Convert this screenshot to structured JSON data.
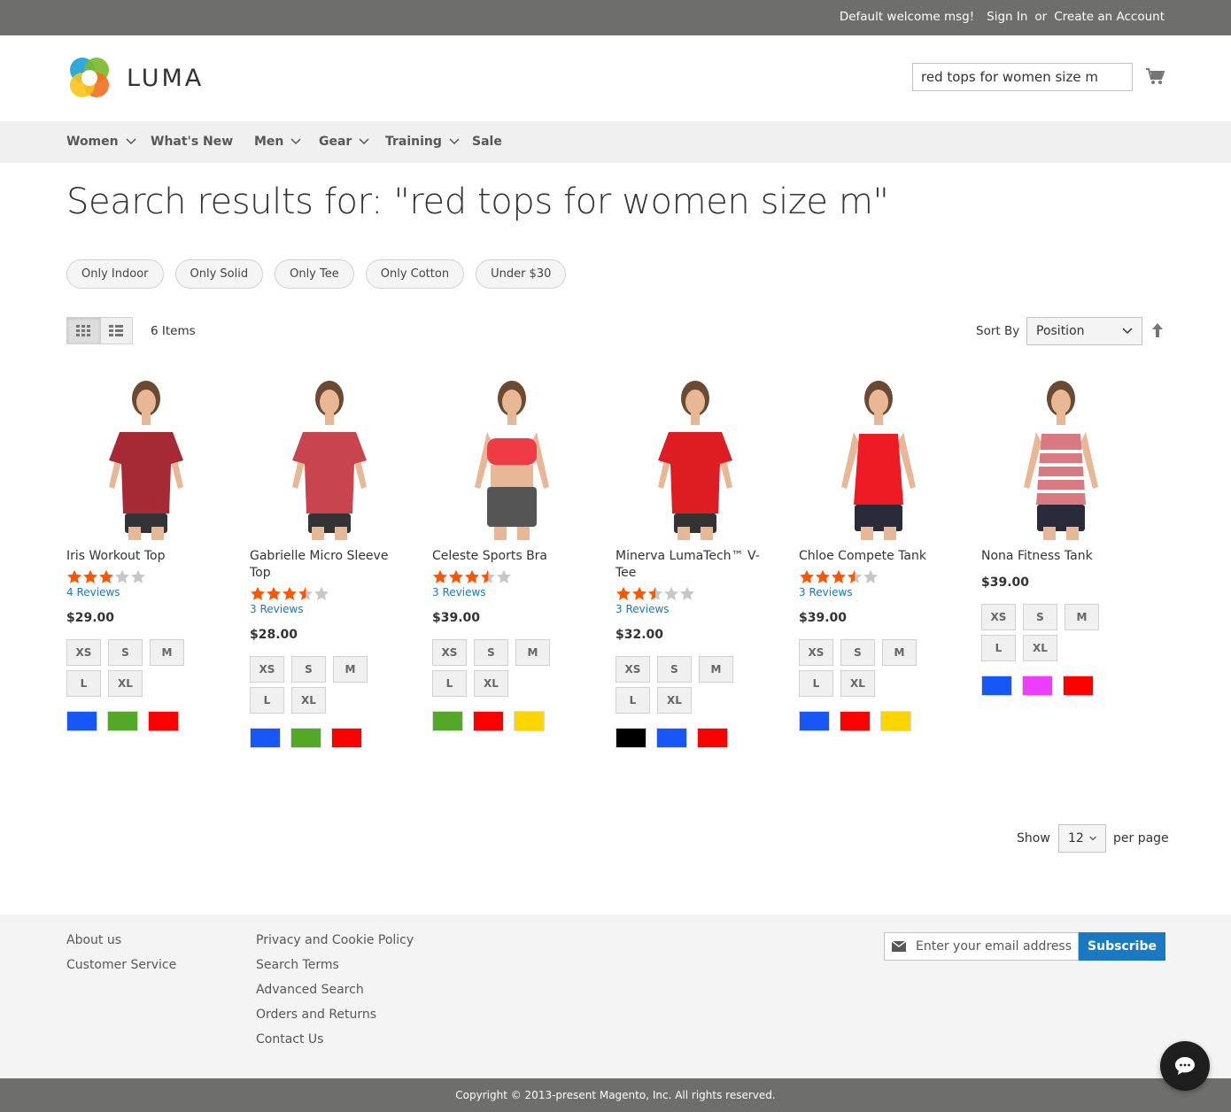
{
  "topbar": {
    "welcome": "Default welcome msg!",
    "sign_in": "Sign In",
    "or": "or",
    "create_account": "Create an Account"
  },
  "header": {
    "logo_text": "LUMA",
    "search_value": "red tops for women size m"
  },
  "nav": {
    "items": [
      "Women",
      "What's New",
      "Men",
      "Gear",
      "Training",
      "Sale"
    ]
  },
  "page": {
    "title": "Search results for: \"red tops for women size m\""
  },
  "chips": [
    "Only Indoor",
    "Only Solid",
    "Only Tee",
    "Only Cotton",
    "Under $30"
  ],
  "toolbar": {
    "count": "6 Items",
    "sort_label": "Sort By",
    "sort_value": "Position",
    "show_label": "Show",
    "limit_value": "12",
    "per_page_label": "per page"
  },
  "products": [
    {
      "name": "Iris Workout Top",
      "rating": 3,
      "reviews": "4  Reviews",
      "price": "$29.00",
      "sizes": [
        "XS",
        "S",
        "M",
        "L",
        "XL"
      ],
      "colors": [
        "#1857f7",
        "#53a828",
        "#ff0000"
      ],
      "shirt": "#a52a36"
    },
    {
      "name": "Gabrielle Micro Sleeve Top",
      "rating": 3.5,
      "reviews": "3  Reviews",
      "price": "$28.00",
      "sizes": [
        "XS",
        "S",
        "M",
        "L",
        "XL"
      ],
      "colors": [
        "#1857f7",
        "#53a828",
        "#ff0000"
      ],
      "shirt": "#c84550"
    },
    {
      "name": "Celeste Sports Bra",
      "rating": 3.5,
      "reviews": "3  Reviews",
      "price": "$39.00",
      "sizes": [
        "XS",
        "S",
        "M",
        "L",
        "XL"
      ],
      "colors": [
        "#53a828",
        "#ff0000",
        "#ffd500"
      ],
      "shirt": "#ee3b45"
    },
    {
      "name": "Minerva LumaTech™ V-Tee",
      "rating": 2.5,
      "reviews": "3  Reviews",
      "price": "$32.00",
      "sizes": [
        "XS",
        "S",
        "M",
        "L",
        "XL"
      ],
      "colors": [
        "#000000",
        "#1857f7",
        "#ff0000"
      ],
      "shirt": "#dd1d22"
    },
    {
      "name": "Chloe Compete Tank",
      "rating": 3.5,
      "reviews": "3  Reviews",
      "price": "$39.00",
      "sizes": [
        "XS",
        "S",
        "M",
        "L",
        "XL"
      ],
      "colors": [
        "#1857f7",
        "#ff0000",
        "#ffd500"
      ],
      "shirt": "#ee1b24"
    },
    {
      "name": "Nona Fitness Tank",
      "rating": 0,
      "reviews": "",
      "price": "$39.00",
      "sizes": [
        "XS",
        "S",
        "M",
        "L",
        "XL"
      ],
      "colors": [
        "#1857f7",
        "#ef3dff",
        "#ff0000"
      ],
      "shirt": "#d87a80"
    }
  ],
  "footer": {
    "col1": [
      "About us",
      "Customer Service"
    ],
    "col2": [
      "Privacy and Cookie Policy",
      "Search Terms",
      "Advanced Search",
      "Orders and Returns",
      "Contact Us"
    ],
    "newsletter_placeholder": "Enter your email address",
    "subscribe": "Subscribe",
    "copyright": "Copyright © 2013-present Magento, Inc. All rights reserved."
  },
  "colors": {
    "accent": "#1979c3",
    "star": "#ff5501",
    "topbar": "#6e6e6c"
  }
}
